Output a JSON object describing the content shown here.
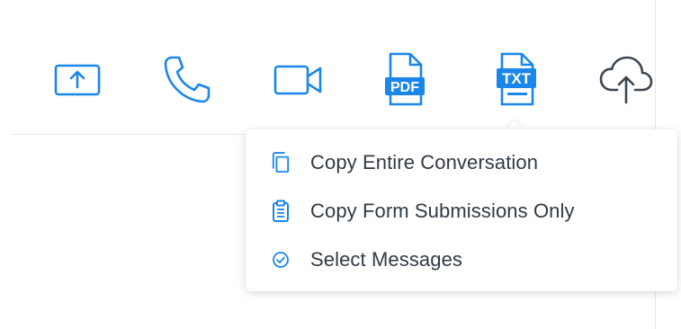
{
  "colors": {
    "accent": "#1a86e8",
    "icon_gray": "#3c4650",
    "text": "#2f3a45",
    "divider": "#e6e8eb"
  },
  "toolbar": {
    "buttons": [
      {
        "name": "share-screen",
        "icon": "share-screen-icon"
      },
      {
        "name": "phone-call",
        "icon": "phone-icon"
      },
      {
        "name": "video-call",
        "icon": "video-camera-icon"
      },
      {
        "name": "export-pdf",
        "icon": "pdf-file-icon",
        "label": "PDF"
      },
      {
        "name": "export-txt",
        "icon": "txt-file-icon",
        "label": "TXT"
      },
      {
        "name": "upload",
        "icon": "cloud-upload-icon"
      }
    ]
  },
  "menu": {
    "items": [
      {
        "label": "Copy Entire Conversation",
        "icon": "copy-icon"
      },
      {
        "label": "Copy Form Submissions Only",
        "icon": "clipboard-icon"
      },
      {
        "label": "Select Messages",
        "icon": "check-circle-icon"
      }
    ]
  }
}
